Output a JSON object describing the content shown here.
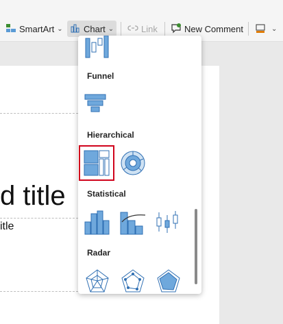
{
  "toolbar": {
    "smartart_label": "SmartArt",
    "chart_label": "Chart",
    "link_label": "Link",
    "new_comment_label": "New Comment"
  },
  "slide": {
    "title_fragment": "d title",
    "subtitle_fragment": "itle"
  },
  "dropdown": {
    "sections": [
      "Funnel",
      "Hierarchical",
      "Statistical",
      "Radar"
    ],
    "funnel_icons": [
      "funnel-chart-icon"
    ],
    "hierarchical_icons": [
      "treemap-chart-icon",
      "sunburst-chart-icon"
    ],
    "statistical_icons": [
      "histogram-chart-icon",
      "pareto-chart-icon",
      "box-whisker-chart-icon"
    ],
    "radar_icons": [
      "radar-chart-icon",
      "radar-markers-chart-icon",
      "filled-radar-chart-icon"
    ],
    "selected": "treemap-chart-icon"
  },
  "colors": {
    "icon_fill": "#6fa8dc",
    "icon_stroke": "#2f6fb3",
    "highlight": "#d0021b"
  }
}
